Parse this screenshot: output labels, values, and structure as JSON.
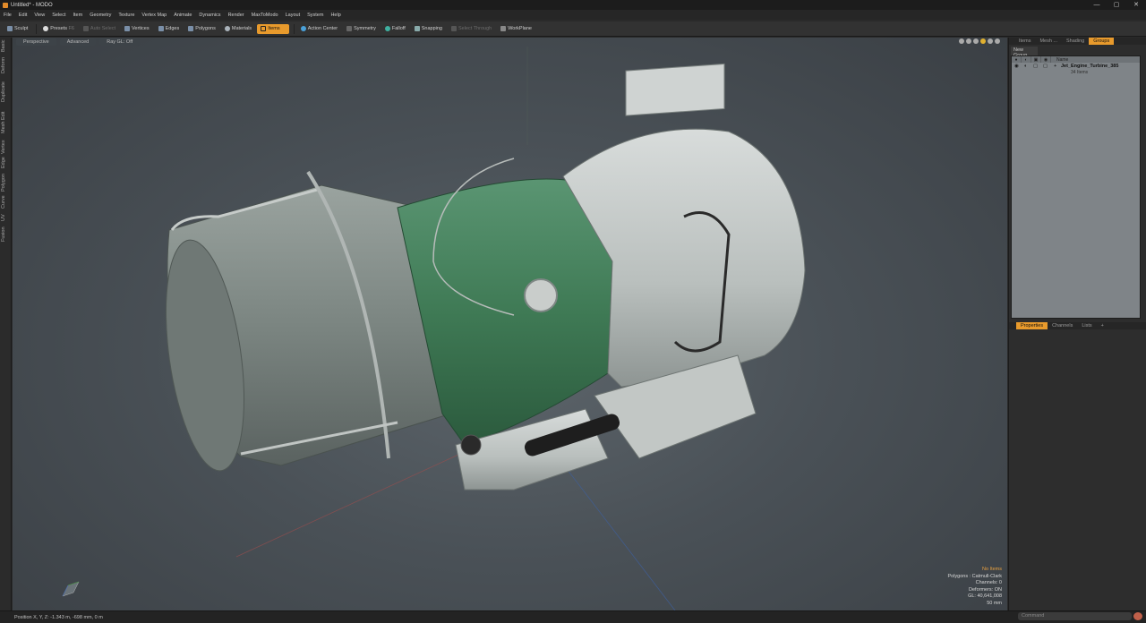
{
  "window": {
    "title": "Untitled* - MODO",
    "controls": [
      "—",
      "▢",
      "✕"
    ]
  },
  "menu": [
    "File",
    "Edit",
    "View",
    "Select",
    "Item",
    "Geometry",
    "Texture",
    "Vertex Map",
    "Animate",
    "Dynamics",
    "Render",
    "MaxToModo",
    "Layout",
    "System",
    "Help"
  ],
  "toolbar": {
    "sculpt": "Sculpt",
    "presets": "Presets",
    "presets_key": "F6",
    "auto_select": "Auto Select",
    "vertices": "Vertices",
    "edges": "Edges",
    "polygons": "Polygons",
    "materials": "Materials",
    "items": "Items",
    "action_center": "Action Center",
    "symmetry": "Symmetry",
    "falloff": "Falloff",
    "snapping": "Snapping",
    "select_through": "Select Through",
    "workplane": "WorkPlane"
  },
  "left_tabs": [
    "Basic",
    "Deform",
    "Duplicate",
    "Mesh Edit",
    "Vertex",
    "Edge",
    "Polygon",
    "Curve",
    "UV",
    "Fusion"
  ],
  "viewport": {
    "tabs": [
      "Perspective",
      "Advanced",
      "Ray GL: Off"
    ],
    "stats": {
      "selection": "No Items",
      "polygons": "Polygons : Catmull-Clark",
      "channels": "Channels: 0",
      "deformers": "Deformers: ON",
      "gl": "GL: 40,641,008",
      "scale": "50 mm"
    }
  },
  "right_panel": {
    "tabs": [
      "Items",
      "Mesh ...",
      "Shading",
      "Groups"
    ],
    "active_tab": "Groups",
    "new_group": "New Group",
    "list_header": "Name",
    "group_name": "Jet_Engine_Turbine_385",
    "group_sub": "34 Items",
    "props_tabs": [
      "Properties",
      "Channels",
      "Lists",
      "+"
    ]
  },
  "status": {
    "position": "Position X, Y, Z:  -1.343 m, -698 mm, 0 m",
    "command_placeholder": "Command"
  },
  "colors": {
    "accent": "#e89a2c",
    "engine_green": "#3f7a55",
    "engine_grey": "#8a9590"
  }
}
